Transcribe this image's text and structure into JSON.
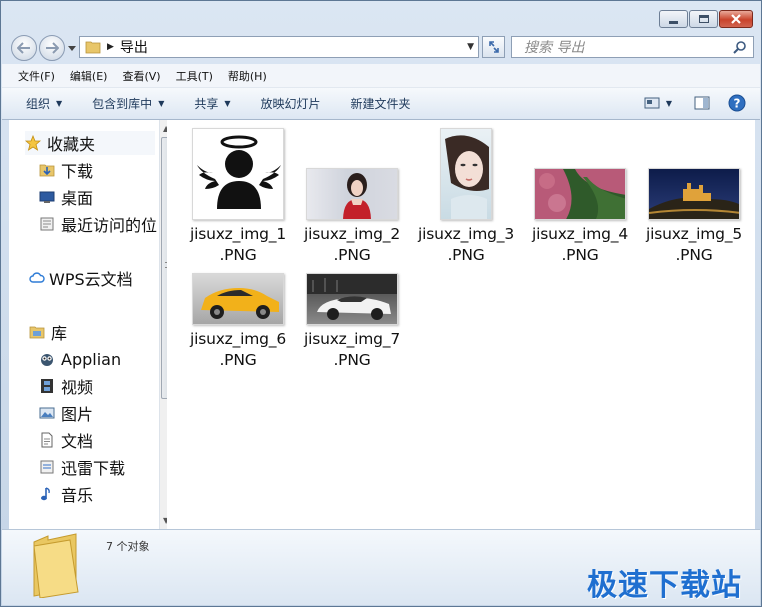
{
  "window": {
    "controls": [
      "minimize",
      "maximize",
      "close"
    ]
  },
  "address": {
    "path": "导出"
  },
  "search": {
    "placeholder": "搜索 导出"
  },
  "menubar": [
    {
      "label": "文件(F)"
    },
    {
      "label": "编辑(E)"
    },
    {
      "label": "查看(V)"
    },
    {
      "label": "工具(T)"
    },
    {
      "label": "帮助(H)"
    }
  ],
  "commandbar": {
    "organize": "组织",
    "include_library": "包含到库中",
    "share": "共享",
    "slideshow": "放映幻灯片",
    "new_folder": "新建文件夹"
  },
  "navpane": {
    "favorites": "收藏夹",
    "downloads": "下载",
    "desktop": "桌面",
    "recent": "最近访问的位",
    "wps": "WPS云文档",
    "libraries": "库",
    "applian": "Applian",
    "videos": "视频",
    "pictures": "图片",
    "documents": "文档",
    "thunder": "迅雷下载",
    "music": "音乐"
  },
  "files": [
    {
      "name_line1": "jisuxz_img_1",
      "name_line2": ".PNG"
    },
    {
      "name_line1": "jisuxz_img_2",
      "name_line2": ".PNG"
    },
    {
      "name_line1": "jisuxz_img_3",
      "name_line2": ".PNG"
    },
    {
      "name_line1": "jisuxz_img_4",
      "name_line2": ".PNG"
    },
    {
      "name_line1": "jisuxz_img_5",
      "name_line2": ".PNG"
    },
    {
      "name_line1": "jisuxz_img_6",
      "name_line2": ".PNG"
    },
    {
      "name_line1": "jisuxz_img_7",
      "name_line2": ".PNG"
    }
  ],
  "details": {
    "count": "7 个对象"
  },
  "watermark": "极速下载站"
}
